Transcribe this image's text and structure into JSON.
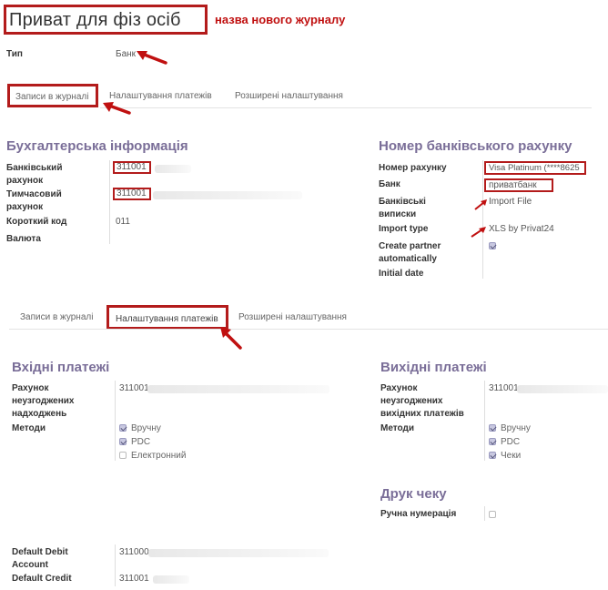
{
  "header": {
    "title": "Приват для фіз осіб",
    "annotation": "назва нового журналу"
  },
  "type_field": {
    "label": "Тип",
    "value": "Банк"
  },
  "tabs_top": [
    "Записи в журналі",
    "Налаштування платежів",
    "Розширені налаштування"
  ],
  "accounting": {
    "heading": "Бухгалтерська інформація",
    "bank_account_label_1": "Банківський",
    "bank_account_label_2": "рахунок",
    "bank_account_value": "311001",
    "temp_account_label_1": "Тимчасовий",
    "temp_account_label_2": "рахунок",
    "temp_account_value": "311001",
    "short_code_label": "Короткий код",
    "short_code_value": "011",
    "currency_label": "Валюта"
  },
  "bank_account": {
    "heading": "Номер банківського рахунку",
    "account_number_label": "Номер рахунку",
    "account_number_value": "Visa Platinum (****8625",
    "bank_label": "Банк",
    "bank_value": "приватбанк",
    "statements_label_1": "Банківські",
    "statements_label_2": "виписки",
    "statements_value": "Import File",
    "import_type_label": "Import type",
    "import_type_value": "XLS by Privat24",
    "create_partner_label_1": "Create partner",
    "create_partner_label_2": "automatically",
    "create_partner_checked": true,
    "initial_date_label": "Initial date"
  },
  "tabs_bottom": [
    "Записи в журналі",
    "Налаштування платежів",
    "Розширені налаштування"
  ],
  "incoming": {
    "heading": "Вхідні платежі",
    "account_label_1": "Рахунок",
    "account_label_2": "неузгоджених",
    "account_label_3": "надходжень",
    "account_value": "311001",
    "methods_label": "Методи",
    "methods": [
      {
        "label": "Вручну",
        "checked": true
      },
      {
        "label": "PDC",
        "checked": true
      },
      {
        "label": "Електронний",
        "checked": false
      }
    ]
  },
  "outgoing": {
    "heading": "Вихідні платежі",
    "account_label_1": "Рахунок",
    "account_label_2": "неузгоджених",
    "account_label_3": "вихідних платежів",
    "account_value": "311001",
    "methods_label": "Методи",
    "methods": [
      {
        "label": "Вручну",
        "checked": true
      },
      {
        "label": "PDC",
        "checked": true
      },
      {
        "label": "Чеки",
        "checked": true
      }
    ]
  },
  "check_print": {
    "heading": "Друк чеку",
    "manual_numbering_label": "Ручна нумерація",
    "manual_numbering_checked": false
  },
  "defaults": {
    "debit_label_1": "Default Debit",
    "debit_label_2": "Account",
    "debit_value": "311000",
    "credit_label": "Default Credit",
    "credit_value": "311001"
  },
  "colors": {
    "highlight": "#b31b1b",
    "heading": "#7a6e98"
  }
}
